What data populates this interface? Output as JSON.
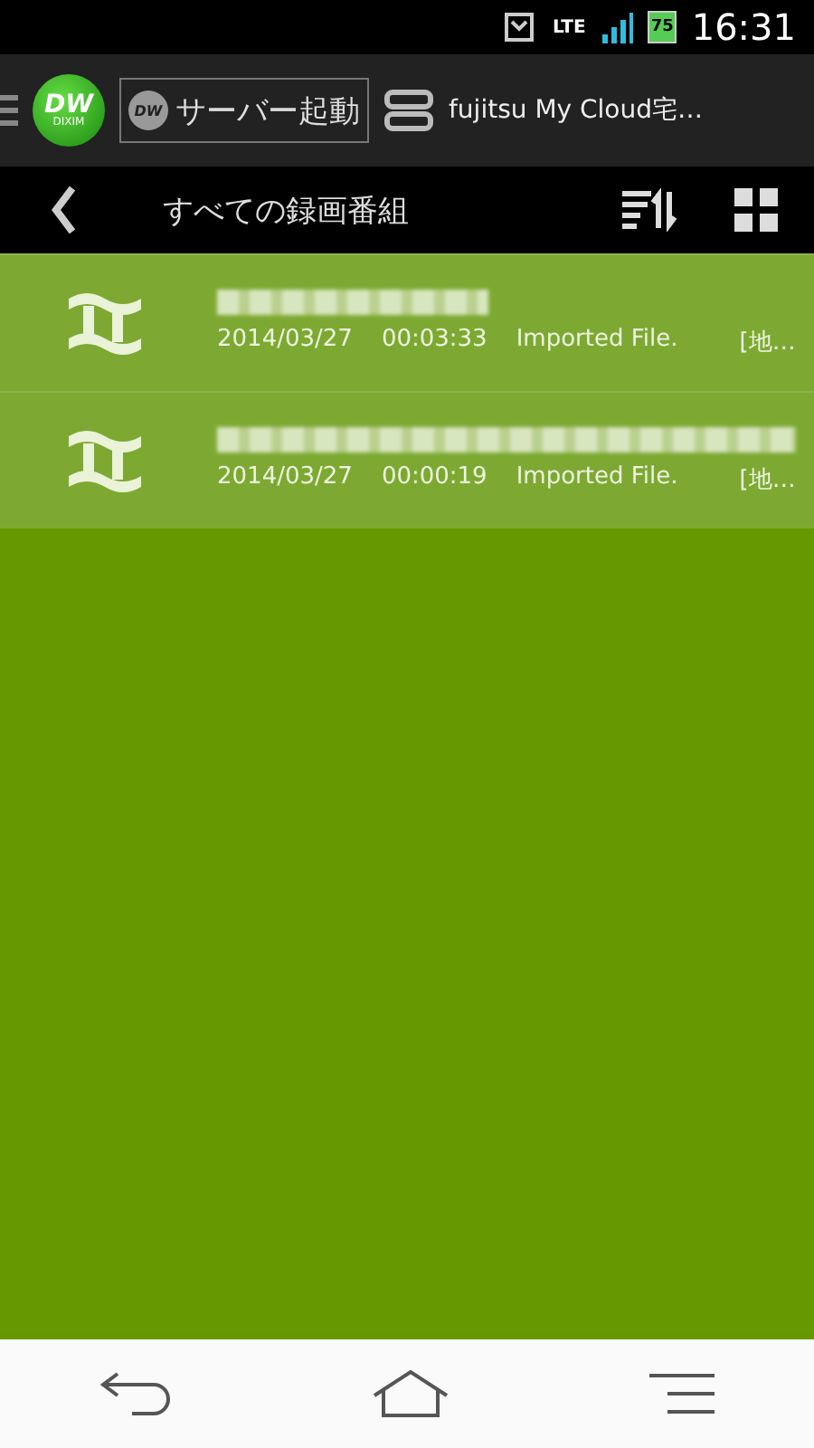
{
  "status_bar": {
    "network": "LTE",
    "battery": "75",
    "time": "16:31"
  },
  "app_bar": {
    "logo": {
      "mark": "DW",
      "name": "DIXIM"
    },
    "server_button": {
      "mark": "DW",
      "label": "サーバー起動"
    },
    "server_name": "fujitsu My Cloud宅…"
  },
  "sub_bar": {
    "title": "すべての録画番組"
  },
  "recordings": [
    {
      "date": "2014/03/27",
      "duration": "00:03:33",
      "source": "Imported File.",
      "channel": "[地…"
    },
    {
      "date": "2014/03/27",
      "duration": "00:00:19",
      "source": "Imported File.",
      "channel": "[地…"
    }
  ]
}
